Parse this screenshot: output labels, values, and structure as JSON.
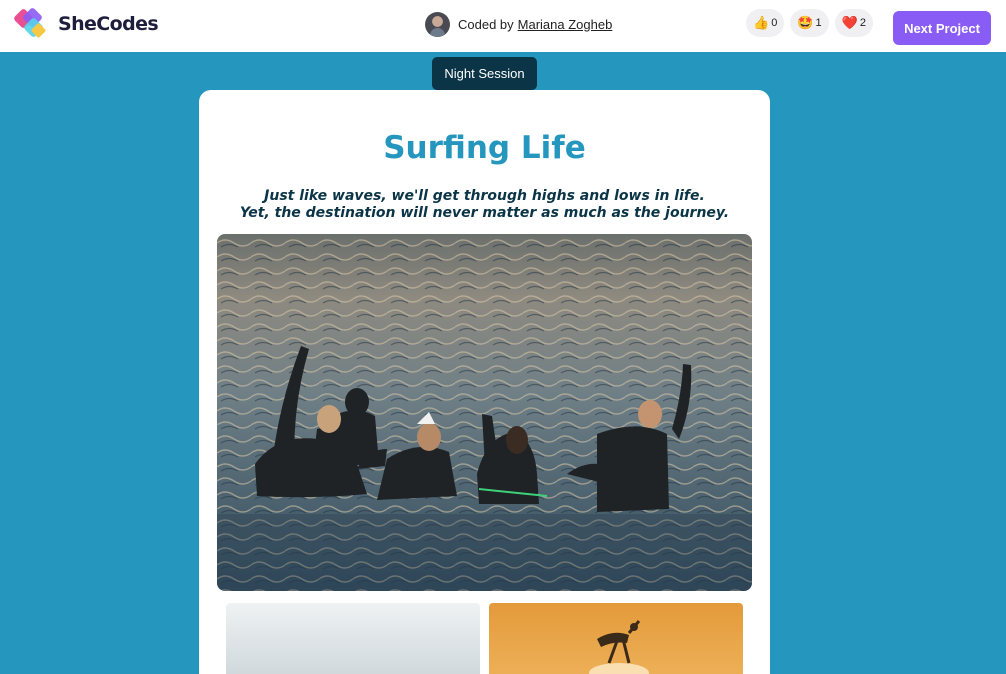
{
  "header": {
    "brand_name": "SheCodes",
    "coded_by_prefix": "Coded by",
    "author_name": "Mariana Zogheb",
    "reactions": [
      {
        "emoji": "👍",
        "count": "0"
      },
      {
        "emoji": "🤩",
        "count": "1"
      },
      {
        "emoji": "❤️",
        "count": "2"
      }
    ],
    "next_project_label": "Next Project"
  },
  "toggle": {
    "label": "Night Session"
  },
  "card": {
    "title": "Surfing Life",
    "quote_line1": "Just like waves, we'll get through highs and lows in life.",
    "quote_line2": "Yet, the destination will never matter as much as the journey."
  },
  "colors": {
    "page_background": "#2596be",
    "title": "#2596be",
    "quote_and_toggle": "#0b3547",
    "next_button": "#8a5cf6"
  }
}
